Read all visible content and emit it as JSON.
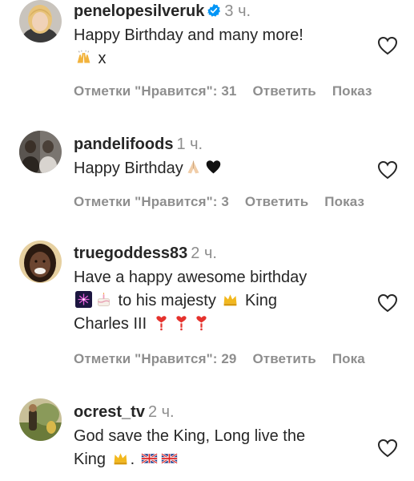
{
  "comments": [
    {
      "username": "penelopesilveruk",
      "verified": true,
      "time": "3 ч.",
      "line1": "Happy Birthday and many more!",
      "line2_suffix": " x",
      "emojis": [
        "raising-hands-emoji"
      ],
      "likes_label": "Отметки \"Нравится\": 31",
      "reply_label": "Ответить",
      "more_label": "Показ"
    },
    {
      "username": "pandelifoods",
      "verified": false,
      "time": "1 ч.",
      "line1": "Happy Birthday",
      "emojis": [
        "folded-hands-emoji",
        "black-heart-emoji"
      ],
      "likes_label": "Отметки \"Нравится\": 3",
      "reply_label": "Ответить",
      "more_label": "Показ"
    },
    {
      "username": "truegoddess83",
      "verified": false,
      "time": "2 ч.",
      "line1": "Have a happy awesome birthday",
      "line2": " to his majesty ",
      "line2_b": " King",
      "line3": "Charles III ",
      "emojis": [
        "fireworks-emoji",
        "birthday-cake-emoji",
        "crown-emoji",
        "heart-exclamation-emoji"
      ],
      "likes_label": "Отметки \"Нравится\": 29",
      "reply_label": "Ответить",
      "more_label": "Пока"
    },
    {
      "username": "ocrest_tv",
      "verified": false,
      "time": "2 ч.",
      "line1": "God save the King, Long live the",
      "line2": "King ",
      "line2_b": ". ",
      "emojis": [
        "crown-emoji",
        "uk-flag-emoji"
      ]
    }
  ],
  "colors": {
    "text": "#262626",
    "secondary": "#8e8e8e",
    "verified": "#0095f6"
  }
}
